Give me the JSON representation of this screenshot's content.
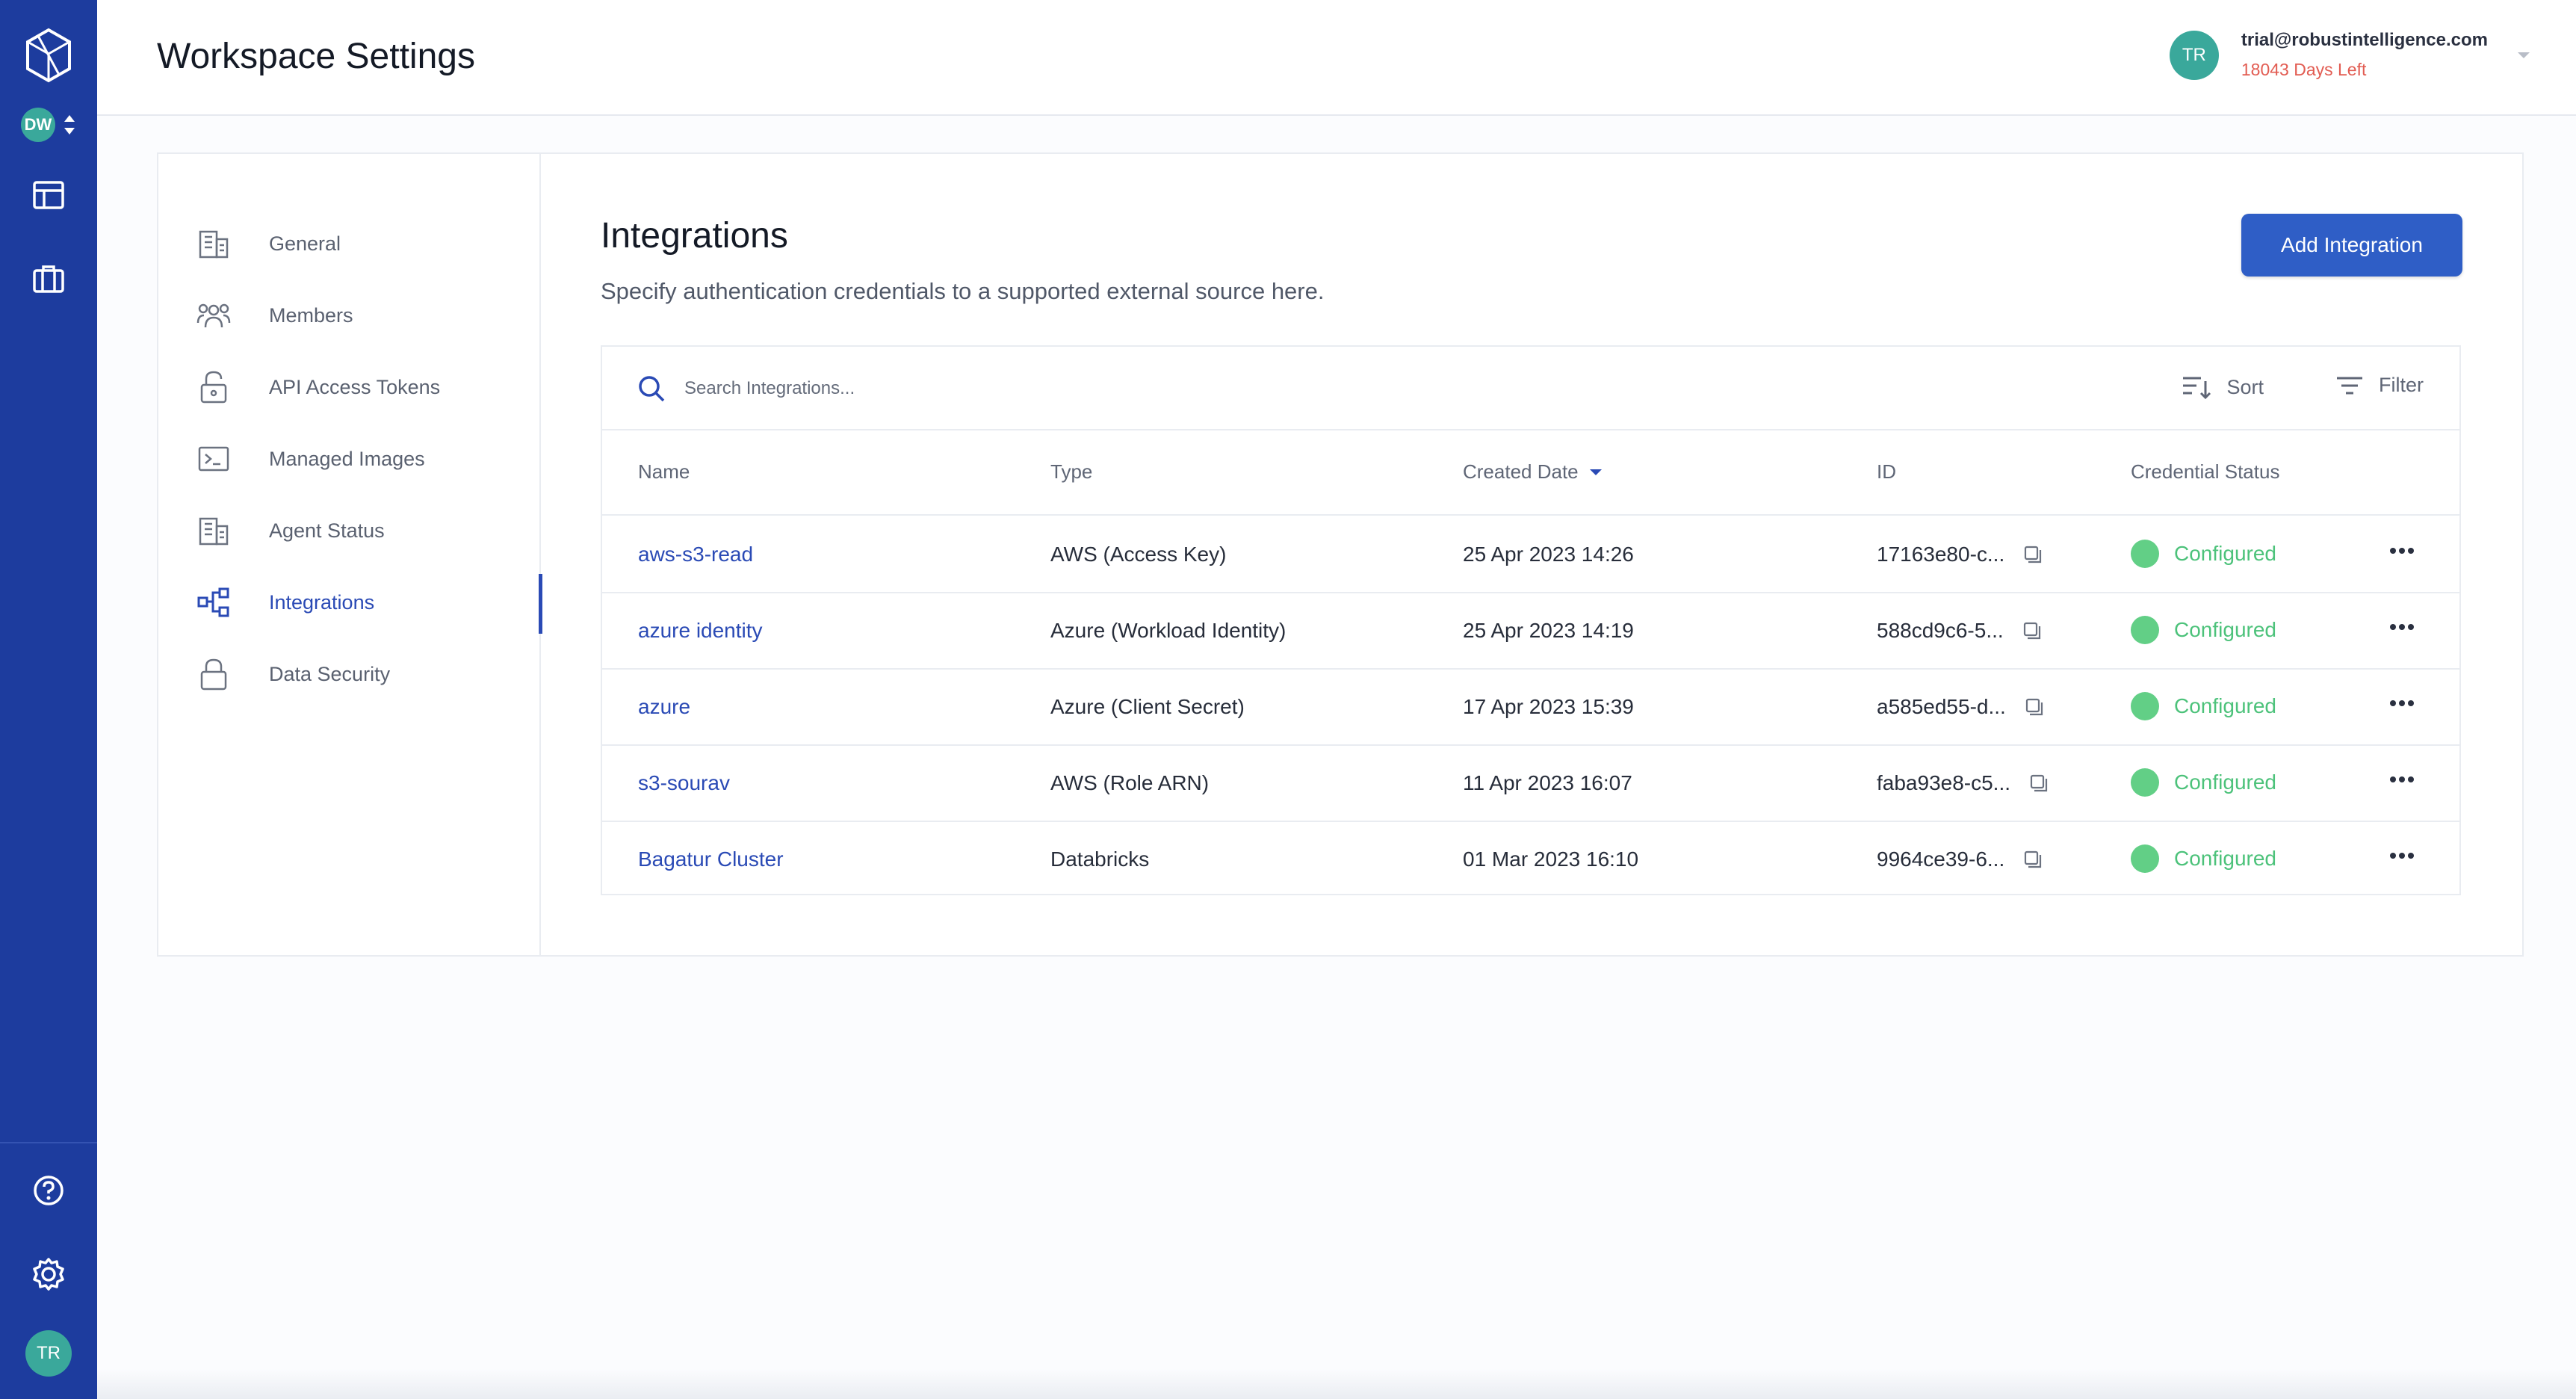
{
  "rail": {
    "workspace_badge": "DW",
    "avatar": "TR",
    "icons": [
      "logo-icon",
      "workspace-switch-icon",
      "layout-icon",
      "briefcase-icon",
      "help-icon",
      "settings-icon"
    ],
    "color": "#1d3c9e"
  },
  "header": {
    "title": "Workspace Settings",
    "user": {
      "initials": "TR",
      "email": "trial@robustintelligence.com",
      "days_left": "18043 Days Left"
    }
  },
  "nav": {
    "items": [
      {
        "label": "General",
        "icon": "building-icon"
      },
      {
        "label": "Members",
        "icon": "members-icon"
      },
      {
        "label": "API Access Tokens",
        "icon": "lock-open-icon"
      },
      {
        "label": "Managed Images",
        "icon": "terminal-icon"
      },
      {
        "label": "Agent Status",
        "icon": "building-icon"
      },
      {
        "label": "Integrations",
        "icon": "integrations-icon",
        "active": true
      },
      {
        "label": "Data Security",
        "icon": "lock-icon"
      }
    ]
  },
  "content": {
    "title": "Integrations",
    "subtitle": "Specify authentication credentials to a supported external source here.",
    "add_label": "Add Integration",
    "search_placeholder": "Search Integrations...",
    "sort_label": "Sort",
    "filter_label": "Filter",
    "columns": [
      "Name",
      "Type",
      "Created Date",
      "ID",
      "Credential Status"
    ],
    "rows": [
      {
        "name": "aws-s3-read",
        "type": "AWS (Access Key)",
        "date": "25 Apr 2023 14:26",
        "id": "17163e80-c...",
        "status": "Configured"
      },
      {
        "name": "azure identity",
        "type": "Azure (Workload Identity)",
        "date": "25 Apr 2023 14:19",
        "id": "588cd9c6-5...",
        "status": "Configured"
      },
      {
        "name": "azure",
        "type": "Azure (Client Secret)",
        "date": "17 Apr 2023 15:39",
        "id": "a585ed55-d...",
        "status": "Configured"
      },
      {
        "name": "s3-sourav",
        "type": "AWS (Role ARN)",
        "date": "11 Apr 2023 16:07",
        "id": "faba93e8-c5...",
        "status": "Configured"
      },
      {
        "name": "Bagatur Cluster",
        "type": "Databricks",
        "date": "01 Mar 2023 16:10",
        "id": "9964ce39-6...",
        "status": "Configured"
      }
    ],
    "colors": {
      "accent": "#2f5ec6",
      "status_ok": "#62cf86",
      "warning": "#e25c52"
    }
  }
}
